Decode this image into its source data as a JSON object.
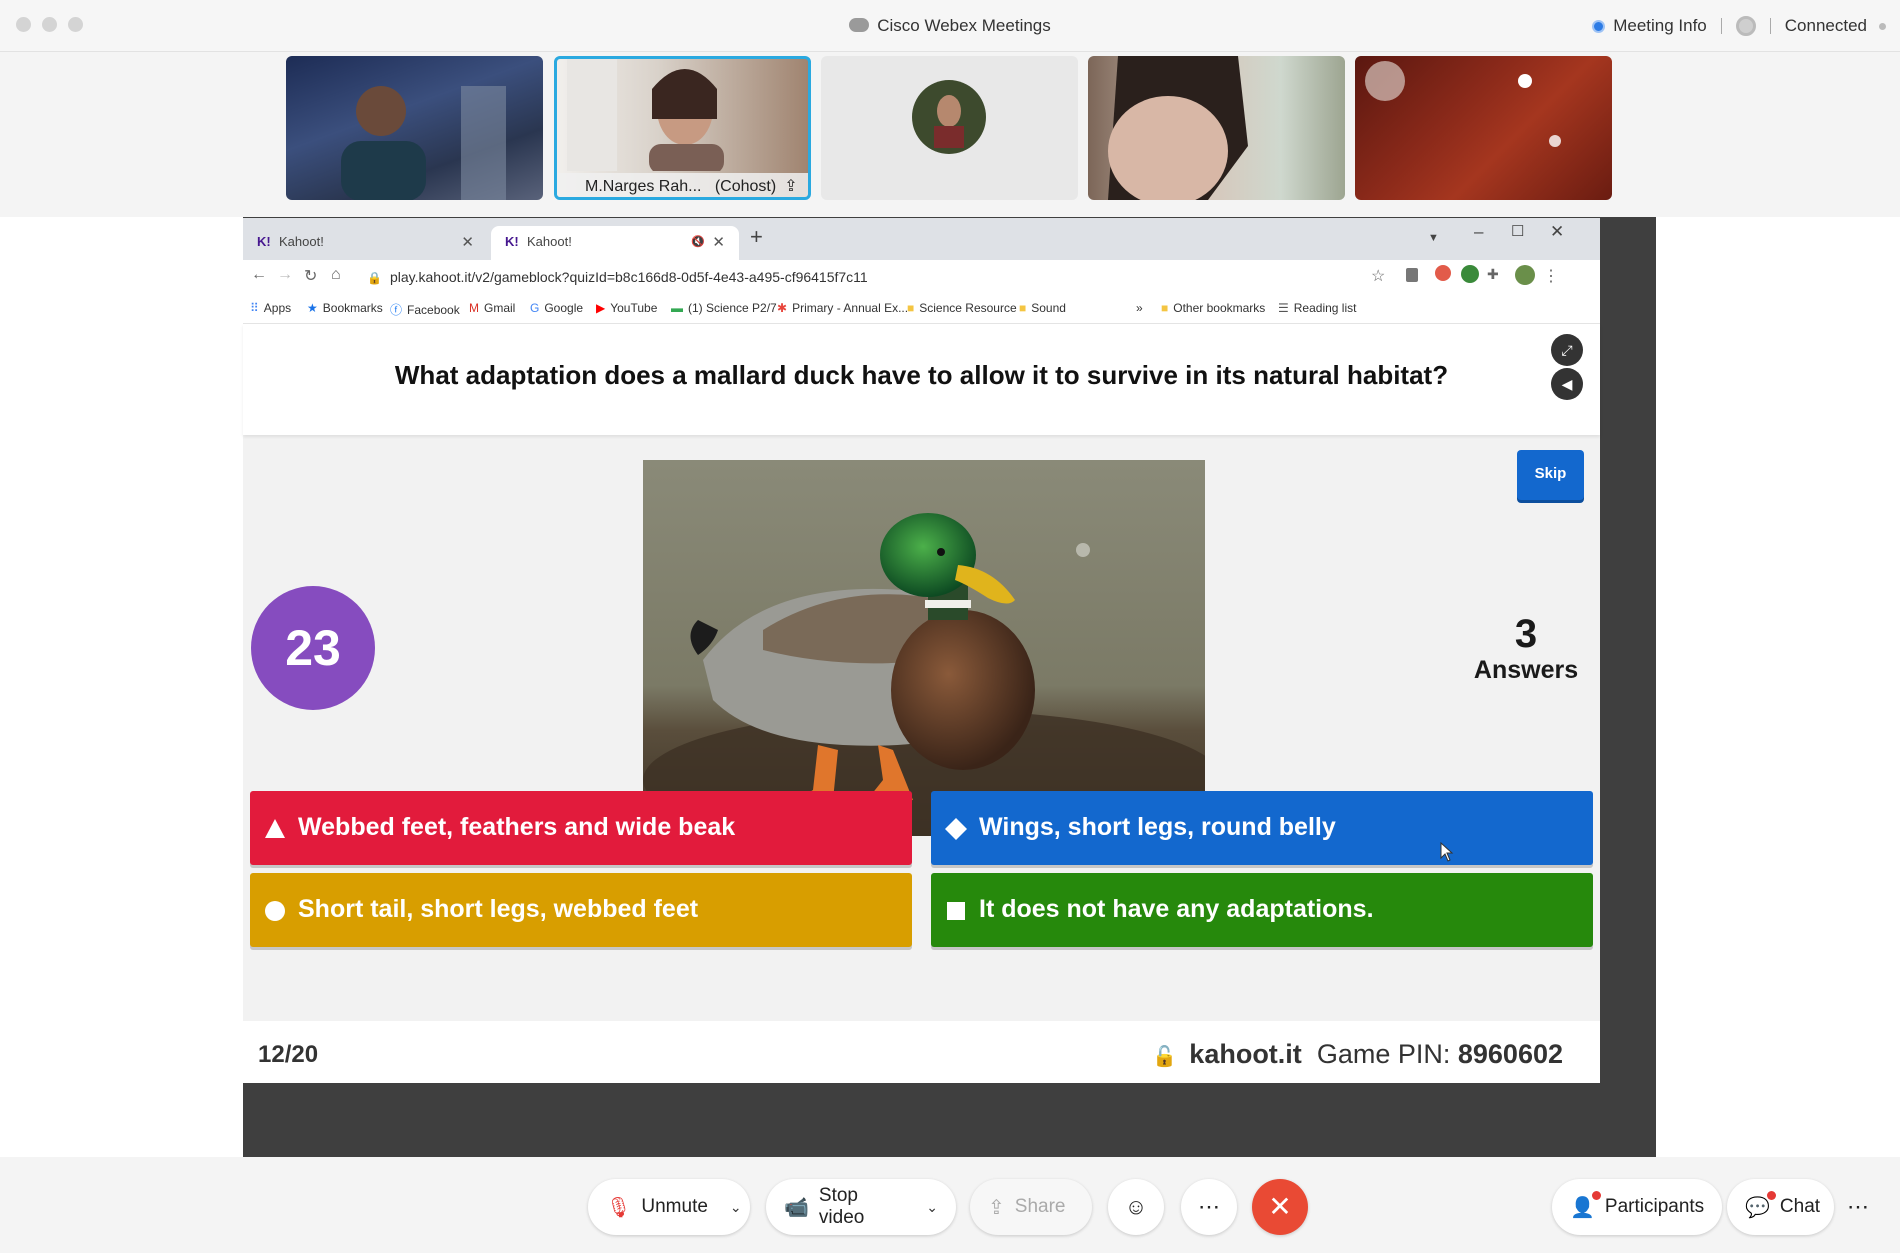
{
  "window": {
    "title": "Cisco Webex Meetings",
    "meeting_info": "Meeting Info",
    "status": "Connected"
  },
  "participants": [
    {
      "name": ""
    },
    {
      "name": "M.Narges Rah...",
      "role": "(Cohost)"
    },
    {
      "name": ""
    },
    {
      "name": ""
    },
    {
      "name": ""
    }
  ],
  "browser": {
    "tabs": [
      {
        "label": "Kahoot!"
      },
      {
        "label": "Kahoot!"
      }
    ],
    "url": "play.kahoot.it/v2/gameblock?quizId=b8c166d8-0d5f-4e43-a495-cf96415f7c11",
    "bookmarks": [
      "Apps",
      "Bookmarks",
      "Facebook",
      "Gmail",
      "Google",
      "YouTube",
      "(1) Science P2/7",
      "Primary - Annual Ex...",
      "Science Resource",
      "Sound"
    ],
    "overflow": "»",
    "other_bookmarks": "Other bookmarks",
    "reading_list": "Reading list"
  },
  "kahoot": {
    "question": "What adaptation does a mallard duck have to allow it to survive in its natural habitat?",
    "skip": "Skip",
    "timer": "23",
    "answers_count": "3",
    "answers_label": "Answers",
    "options": [
      {
        "text": "Webbed feet, feathers and wide beak",
        "color": "#e21b3c",
        "shape": "triangle-icon"
      },
      {
        "text": "Wings, short legs, round belly",
        "color": "#1368ce",
        "shape": "diamond-icon"
      },
      {
        "text": "Short tail, short legs, webbed feet",
        "color": "#d89e00",
        "shape": "circle-icon"
      },
      {
        "text": "It does not have any adaptations.",
        "color": "#26890c",
        "shape": "square-icon"
      }
    ],
    "progress": "12/20",
    "site": "kahoot.it",
    "pin_label": "Game PIN:",
    "pin": "8960602"
  },
  "controls": {
    "unmute": "Unmute",
    "stop_video": "Stop video",
    "share": "Share",
    "participants": "Participants",
    "chat": "Chat"
  }
}
